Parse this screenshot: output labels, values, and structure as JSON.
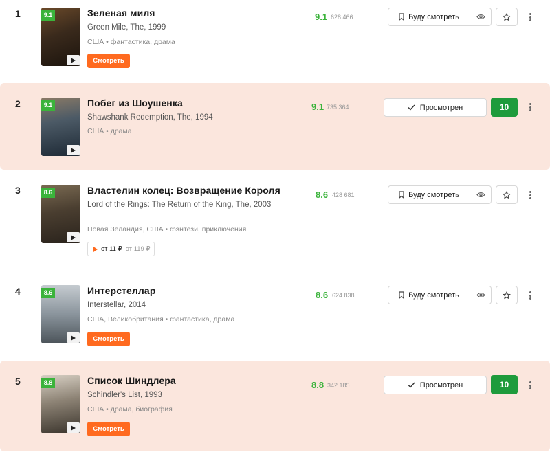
{
  "labels": {
    "watch": "Смотреть",
    "will_watch": "Буду смотреть",
    "watched": "Просмотрен"
  },
  "colors": {
    "rating_green": "#3bb33b",
    "accent_orange": "#ff6a1f",
    "score_green": "#1e9b3c",
    "highlight_row": "#fbe6dd"
  },
  "icons": {
    "bookmark": "bookmark-icon",
    "eye": "eye-icon",
    "star": "star-icon",
    "check": "check-icon",
    "more": "more-vertical-icon",
    "play": "play-icon"
  },
  "films": [
    {
      "rank": "1",
      "title": "Зеленая миля",
      "original": "Green Mile, The, 1999",
      "meta": "США • фантастика, драма",
      "poster_badge": "9.1",
      "rating": "9.1",
      "votes": "628 466",
      "status": "will_watch"
    },
    {
      "rank": "2",
      "title": "Побег из Шоушенка",
      "original": "Shawshank Redemption, The, 1994",
      "meta": "США • драма",
      "poster_badge": "9.1",
      "rating": "9.1",
      "votes": "735 364",
      "status": "watched",
      "user_score": "10"
    },
    {
      "rank": "3",
      "title": "Властелин колец: Возвращение Короля",
      "original": "Lord of the Rings: The Return of the King, The, 2003",
      "meta": "Новая Зеландия, США • фэнтези, приключения",
      "poster_badge": "8.6",
      "rating": "8.6",
      "votes": "428 681",
      "status": "will_watch",
      "price_from": "от 11 ₽",
      "price_old": "от 119 ₽"
    },
    {
      "rank": "4",
      "title": "Интерстеллар",
      "original": "Interstellar, 2014",
      "meta": "США, Великобритания • фантастика, драма",
      "poster_badge": "8.6",
      "rating": "8.6",
      "votes": "624 838",
      "status": "will_watch"
    },
    {
      "rank": "5",
      "title": "Список Шиндлера",
      "original": "Schindler's List, 1993",
      "meta": "США • драма, биография",
      "poster_badge": "8.8",
      "rating": "8.8",
      "votes": "342 185",
      "status": "watched",
      "user_score": "10"
    }
  ]
}
